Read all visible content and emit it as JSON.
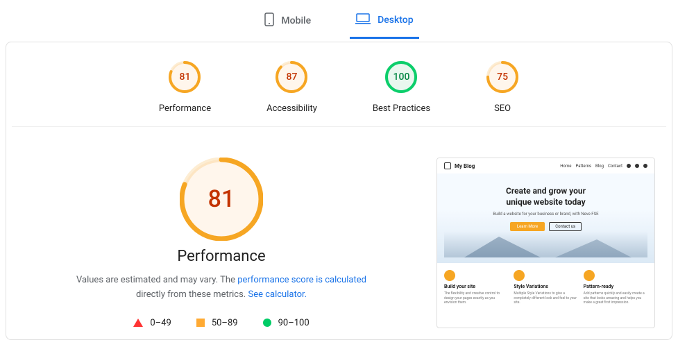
{
  "tabs": {
    "mobile": "Mobile",
    "desktop": "Desktop",
    "active": "desktop"
  },
  "gauges": [
    {
      "label": "Performance",
      "score": 81,
      "color": "orange"
    },
    {
      "label": "Accessibility",
      "score": 87,
      "color": "orange"
    },
    {
      "label": "Best Practices",
      "score": 100,
      "color": "green"
    },
    {
      "label": "SEO",
      "score": 75,
      "color": "orange"
    }
  ],
  "main": {
    "score": 81,
    "color": "orange",
    "title": "Performance",
    "desc1": "Values are estimated and may vary. The ",
    "link1": "performance score is calculated",
    "desc2": " directly from these metrics. ",
    "link2": "See calculator."
  },
  "legend": {
    "r1": "0–49",
    "r2": "50–89",
    "r3": "90–100"
  },
  "preview": {
    "brand": "My Blog",
    "nav": [
      "Home",
      "Patterns",
      "Blog",
      "Contact"
    ],
    "hero_h1a": "Create and grow your",
    "hero_h1b": "unique website today",
    "hero_sub": "Build a website for your business or brand, with Neve FSE",
    "btn1": "Learn More",
    "btn2": "Contact us",
    "features": [
      {
        "title": "Build your site",
        "text": "The flexibility and creative control to design your pages exactly as you envision them."
      },
      {
        "title": "Style Variations",
        "text": "Multiple Style Variations to give a completely different look and feel to your site."
      },
      {
        "title": "Pattern-ready",
        "text": "Add patterns quickly and easily create a site that looks amazing and helps you make a great first impression."
      }
    ]
  },
  "colors": {
    "orange": "#f6a623",
    "green": "#0cce6b",
    "red": "#ff3333",
    "blue": "#1a73e8"
  }
}
